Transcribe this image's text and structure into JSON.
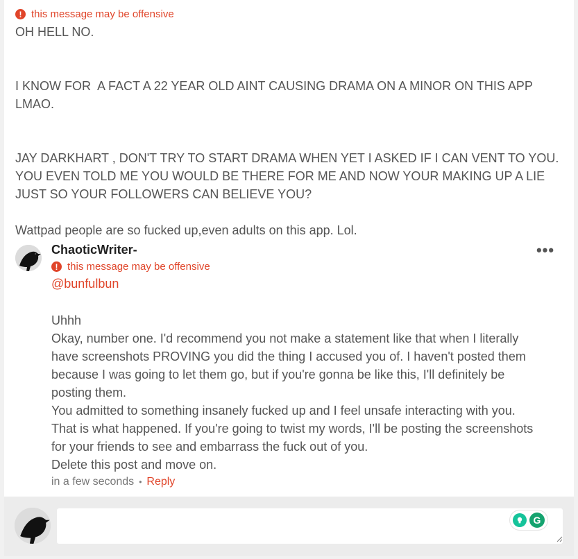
{
  "post": {
    "warning": "this message may be offensive",
    "paragraphs": [
      "OH HELL NO.",
      "",
      "",
      "I KNOW FOR  A FACT A 22 YEAR OLD AINT CAUSING DRAMA ON A MINOR ON THIS APP LMAO.",
      "",
      "",
      "JAY DARKHART , DON'T TRY TO START DRAMA WHEN YET I ASKED IF I CAN VENT TO YOU. YOU EVEN TOLD ME YOU WOULD BE THERE FOR ME AND NOW YOUR MAKING UP A LIE JUST SO YOUR FOLLOWERS CAN BELIEVE YOU?",
      "",
      "Wattpad people are so fucked up,even adults on this app. Lol."
    ]
  },
  "reply": {
    "author": "ChaoticWriter-",
    "warning": "this message may be offensive",
    "mention": "@bunfulbun",
    "lines": [
      "Uhhh",
      "Okay, number one. I'd recommend you not make a statement like that when I literally have screenshots PROVING you did the thing I accused you of. I haven't posted them because I was going to let them go, but if you're gonna be like this, I'll definitely be posting them.",
      "You admitted to something insanely fucked up and I feel unsafe interacting with you. That is what happened. If you're going to twist my words, I'll be posting the screenshots for your friends to see and embarrass the fuck out of you.",
      "Delete this post and move on."
    ],
    "timestamp": "in a few seconds",
    "bullet": "•",
    "reply_label": "Reply",
    "more_label": "•••"
  },
  "composer": {
    "placeholder": "",
    "grammarly_letter": "G"
  },
  "colors": {
    "accent": "#e0452a",
    "grammarly": "#15a36f"
  }
}
